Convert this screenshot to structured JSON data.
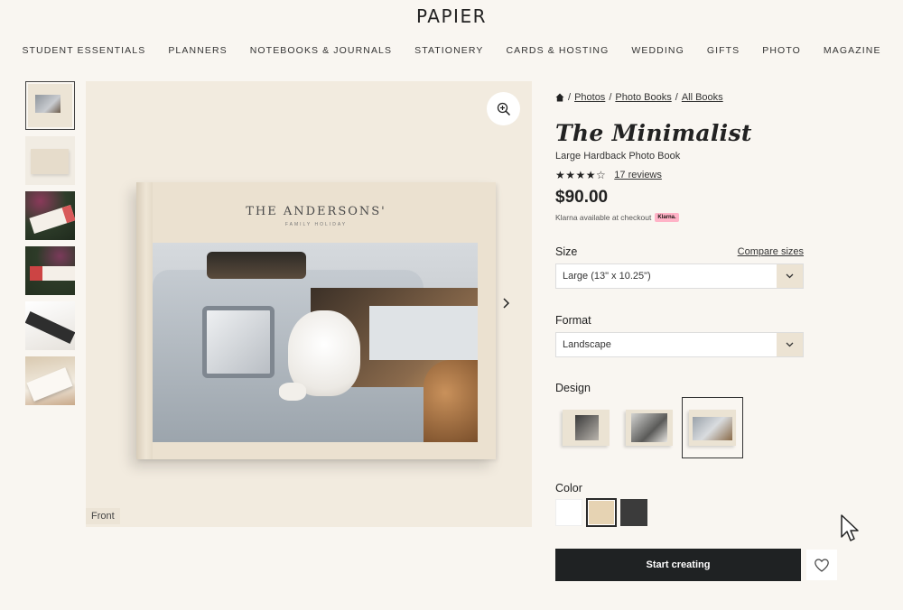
{
  "header": {
    "logo": "PAPIER"
  },
  "nav": {
    "items": [
      "STUDENT ESSENTIALS",
      "PLANNERS",
      "NOTEBOOKS & JOURNALS",
      "STATIONERY",
      "CARDS & HOSTING",
      "WEDDING",
      "GIFTS",
      "PHOTO",
      "MAGAZINE"
    ]
  },
  "gallery": {
    "thumbnails_count": 6,
    "active_thumbnail": 1,
    "front_label": "Front",
    "zoom_icon": "zoom-in-icon",
    "next_icon": "chevron-right-icon",
    "book_cover_title": "THE ANDERSONS'",
    "book_cover_subtitle": "FAMILY HOLIDAY"
  },
  "breadcrumb": {
    "home_icon": "home-icon",
    "separator": "/",
    "items": [
      "Photos",
      "Photo Books",
      "All Books"
    ]
  },
  "product": {
    "title": "The Minimalist",
    "subtitle": "Large Hardback Photo Book",
    "rating": 4.5,
    "stars": "★★★★☆",
    "reviews_label": "17 reviews",
    "price": "$90.00",
    "klarna_text": "Klarna available at checkout",
    "klarna_badge": "Klarna."
  },
  "options": {
    "size_label": "Size",
    "compare_label": "Compare sizes",
    "size_value": "Large (13\" x 10.25\")",
    "format_label": "Format",
    "format_value": "Landscape",
    "design_label": "Design",
    "designs_count": 3,
    "active_design": 3,
    "color_label": "Color",
    "colors": [
      "#ffffff",
      "#e6d3b3",
      "#3b3b3b"
    ],
    "active_color": 2
  },
  "actions": {
    "cta_label": "Start creating",
    "wishlist_icon": "heart-icon"
  }
}
